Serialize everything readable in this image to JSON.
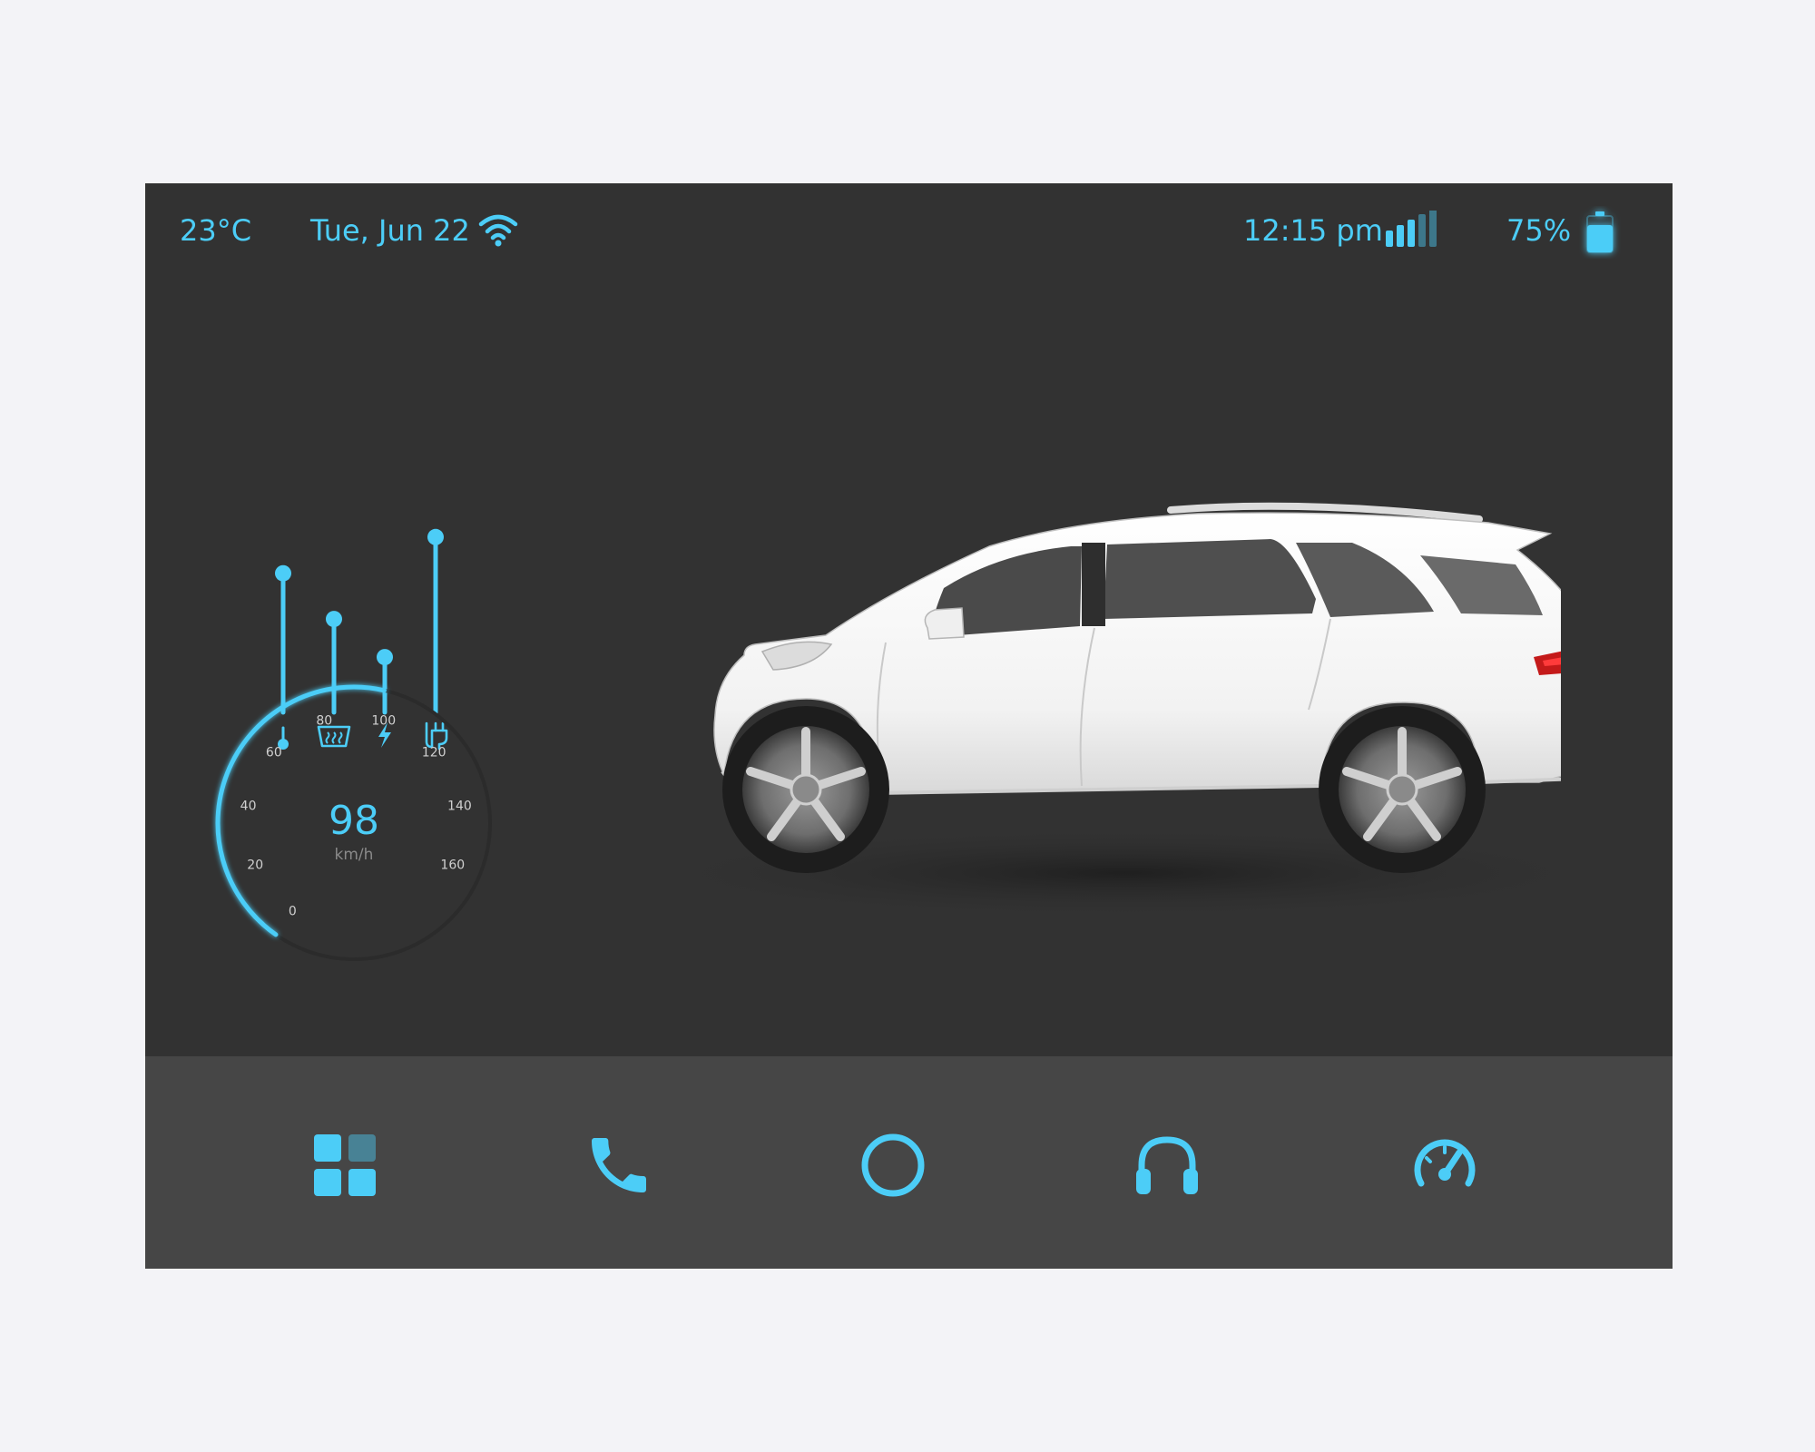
{
  "status": {
    "temperature": "23°C",
    "date": "Tue, Jun 22",
    "time": "12:15 pm",
    "battery_percent": "75%",
    "battery_level": 0.75,
    "signal_bars": 3,
    "signal_bars_total": 5
  },
  "controls": {
    "sliders": [
      {
        "name": "temperature",
        "icon": "thermometer-icon",
        "level": 0.73
      },
      {
        "name": "rear-defrost",
        "icon": "rear-defrost-icon",
        "level": 0.49
      },
      {
        "name": "power",
        "icon": "lightning-icon",
        "level": 0.29
      },
      {
        "name": "charging",
        "icon": "plug-icon",
        "level": 0.92
      }
    ]
  },
  "speedometer": {
    "value": "98",
    "unit": "km/h",
    "speed": 98,
    "max": 180,
    "ticks": [
      "0",
      "20",
      "40",
      "60",
      "80",
      "100",
      "120",
      "140",
      "160"
    ]
  },
  "dock": {
    "items": [
      {
        "name": "apps",
        "icon": "app-grid-icon"
      },
      {
        "name": "phone",
        "icon": "phone-icon"
      },
      {
        "name": "home",
        "icon": "home-circle-icon"
      },
      {
        "name": "music",
        "icon": "headphones-icon"
      },
      {
        "name": "dashboard",
        "icon": "speedometer-icon"
      }
    ]
  },
  "colors": {
    "accent": "#4ccdf7",
    "screen_bg": "#323232",
    "dock_bg": "#464646",
    "page_bg": "#f3f3f7"
  }
}
